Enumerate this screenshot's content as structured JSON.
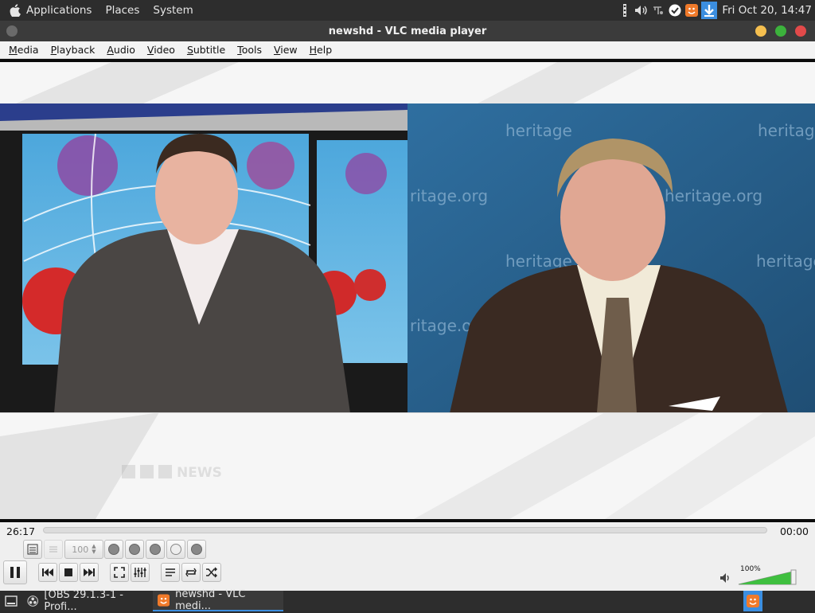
{
  "panel": {
    "menu": [
      "Applications",
      "Places",
      "System"
    ],
    "clock": "Fri Oct 20, 14:47"
  },
  "window": {
    "title": "newshd - VLC media player"
  },
  "menubar": [
    "Media",
    "Playback",
    "Audio",
    "Video",
    "Subtitle",
    "Tools",
    "View",
    "Help"
  ],
  "video": {
    "overlay_logo": "NEWS",
    "background_text": "heritage.org",
    "bg_text_1": "heritage",
    "bg_text_2": "ritage.org",
    "bg_text_3": "heritage",
    "bg_text_4": "heritage"
  },
  "controls": {
    "time_elapsed": "26:17",
    "time_total": "00:00",
    "speed_value": "100",
    "volume_label": "100%",
    "volume_level": 1.0
  },
  "taskbar": {
    "tasks": [
      "[OBS 29.1.3-1 - Profi...",
      "newshd - VLC medi..."
    ]
  },
  "colors": {
    "accent": "#3b8ee0",
    "close": "#f5bf4f",
    "min": "#3cb23c",
    "max": "#e24a4a"
  }
}
